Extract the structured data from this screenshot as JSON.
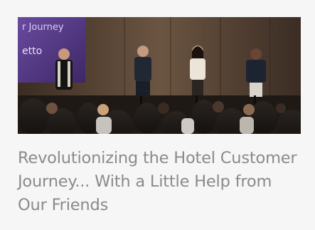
{
  "card": {
    "title": "Revolutionizing the Hotel Customer Journey... With a Little Help from Our Friends",
    "image": {
      "screen_text_line1": "r Journey",
      "screen_text_line2": "etto"
    }
  },
  "colors": {
    "background": "#f6f6f6",
    "title_text": "#8a8a8a",
    "screen_purple": "#5a3a8a"
  }
}
